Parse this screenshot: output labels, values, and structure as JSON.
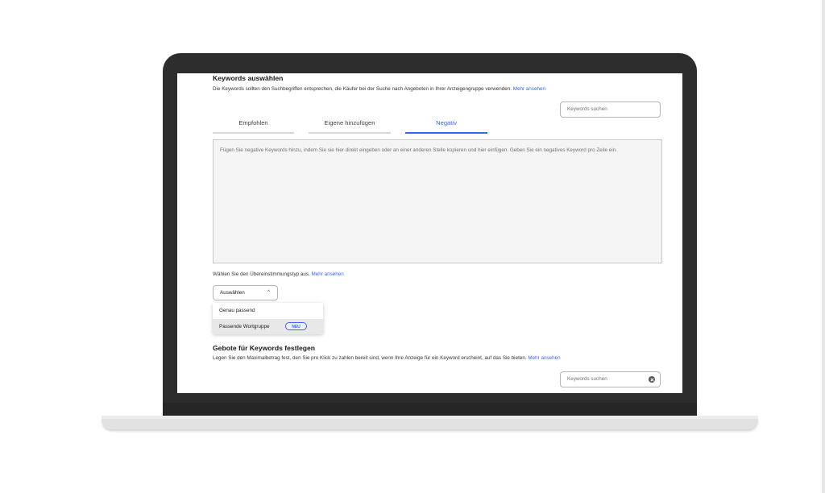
{
  "keywords_section": {
    "title": "Keywords auswählen",
    "description": "Die Keywords sollten den Suchbegriffen entsprechen, die Käufer bei der Suche nach Angeboten in Ihrer Anzeigengruppe verwenden.",
    "more_link": "Mehr ansehen",
    "search_placeholder": "Keywords suchen"
  },
  "tabs": [
    {
      "label": "Empfohlen",
      "active": false
    },
    {
      "label": "Eigene hinzufügen",
      "active": false
    },
    {
      "label": "Negativ",
      "active": true
    }
  ],
  "negative_textarea": {
    "placeholder": "Fügen Sie negative Keywords hinzu, indem Sie sie hier direkt eingeben oder an einer anderen Stelle kopieren und hier einfügen. Geben Sie ein negatives Keyword pro Zeile ein."
  },
  "match_type": {
    "label": "Wählen Sie den Übereinstimmungstyp aus.",
    "more_link": "Mehr ansehen",
    "select_value": "Auswählen",
    "options": [
      {
        "label": "Genau passend",
        "badge": ""
      },
      {
        "label": "Passende Wortgruppe",
        "badge": "NEU"
      }
    ]
  },
  "bids_section": {
    "title": "Gebote für Keywords festlegen",
    "description": "Legen Sie den Maximalbetrag fest, den Sie pro Klick zu zahlen bereit sind, wenn Ihre Anzeige für ein Keyword erscheint, auf das Sie bieten.",
    "more_link": "Mehr ansehen",
    "search_placeholder": "Keywords suchen"
  },
  "colors": {
    "accent": "#3665f3",
    "laptop_frame": "#2d2d2d",
    "laptop_base": "#e2e2e2"
  }
}
